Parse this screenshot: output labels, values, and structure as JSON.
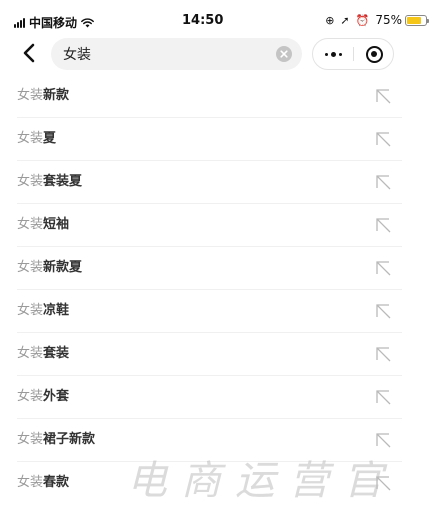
{
  "status_bar": {
    "carrier": "中国移动",
    "time": "14:50",
    "battery": "75%",
    "battery_level": 0.75,
    "battery_color": "#f5c518",
    "icons": [
      "signal-icon",
      "wifi-icon",
      "screen-lock-icon",
      "location-icon",
      "alarm-icon",
      "battery-icon"
    ]
  },
  "nav": {
    "back_icon": "chevron-left-icon",
    "search_value": "女装",
    "clear_icon": "clear-circle-icon",
    "more_icon": "more-dots-icon",
    "close_icon": "mini-program-close-icon"
  },
  "suggestions": [
    {
      "prefix": "女装",
      "suffix": "新款"
    },
    {
      "prefix": "女装",
      "suffix": "夏"
    },
    {
      "prefix": "女装",
      "suffix": "套装夏"
    },
    {
      "prefix": "女装",
      "suffix": "短袖"
    },
    {
      "prefix": "女装",
      "suffix": "新款夏"
    },
    {
      "prefix": "女装",
      "suffix": "凉鞋"
    },
    {
      "prefix": "女装",
      "suffix": "套装"
    },
    {
      "prefix": "女装",
      "suffix": "外套"
    },
    {
      "prefix": "女装",
      "suffix": "裙子新款"
    },
    {
      "prefix": "女装",
      "suffix": "春款"
    }
  ],
  "suggestion_icon": "fill-query-arrow-icon",
  "watermark": "电商运营官"
}
